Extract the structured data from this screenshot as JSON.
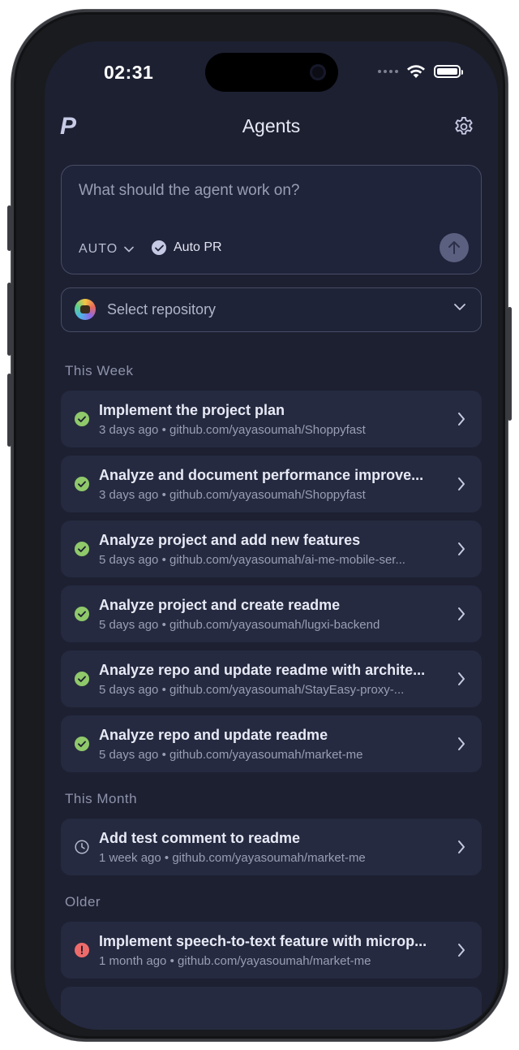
{
  "status_bar": {
    "time": "02:31"
  },
  "header": {
    "logo": "P",
    "title": "Agents"
  },
  "prompt": {
    "placeholder": "What should the agent work on?",
    "mode": "AUTO",
    "auto_pr_label": "Auto PR",
    "auto_pr_checked": true
  },
  "repo_select": {
    "placeholder": "Select repository"
  },
  "sections": [
    {
      "header": "This Week"
    },
    {
      "header": "This Month"
    },
    {
      "header": "Older"
    }
  ],
  "tasks": [
    {
      "title": "Implement the project plan",
      "time": "3 days ago",
      "repo": "github.com/yayasoumah/Shoppyfast",
      "status": "completed"
    },
    {
      "title": "Analyze and document performance improve...",
      "time": "3 days ago",
      "repo": "github.com/yayasoumah/Shoppyfast",
      "status": "completed"
    },
    {
      "title": "Analyze project and add new features",
      "time": "5 days ago",
      "repo": "github.com/yayasoumah/ai-me-mobile-ser...",
      "status": "completed"
    },
    {
      "title": "Analyze project and create readme",
      "time": "5 days ago",
      "repo": "github.com/yayasoumah/lugxi-backend",
      "status": "completed"
    },
    {
      "title": "Analyze repo and update readme with archite...",
      "time": "5 days ago",
      "repo": "github.com/yayasoumah/StayEasy-proxy-...",
      "status": "completed"
    },
    {
      "title": "Analyze repo and update readme",
      "time": "5 days ago",
      "repo": "github.com/yayasoumah/market-me",
      "status": "completed"
    },
    {
      "title": "Add test comment to readme",
      "time": "1 week ago",
      "repo": "github.com/yayasoumah/market-me",
      "status": "pending"
    },
    {
      "title": "Implement speech-to-text feature with microp...",
      "time": "1 month ago",
      "repo": "github.com/yayasoumah/market-me",
      "status": "error"
    }
  ],
  "meta_separator": "•",
  "colors": {
    "background": "#1d2031",
    "card": "#252a40",
    "success": "#8fc96a",
    "error": "#ee6b6b",
    "pending": "#b6b9cc"
  }
}
